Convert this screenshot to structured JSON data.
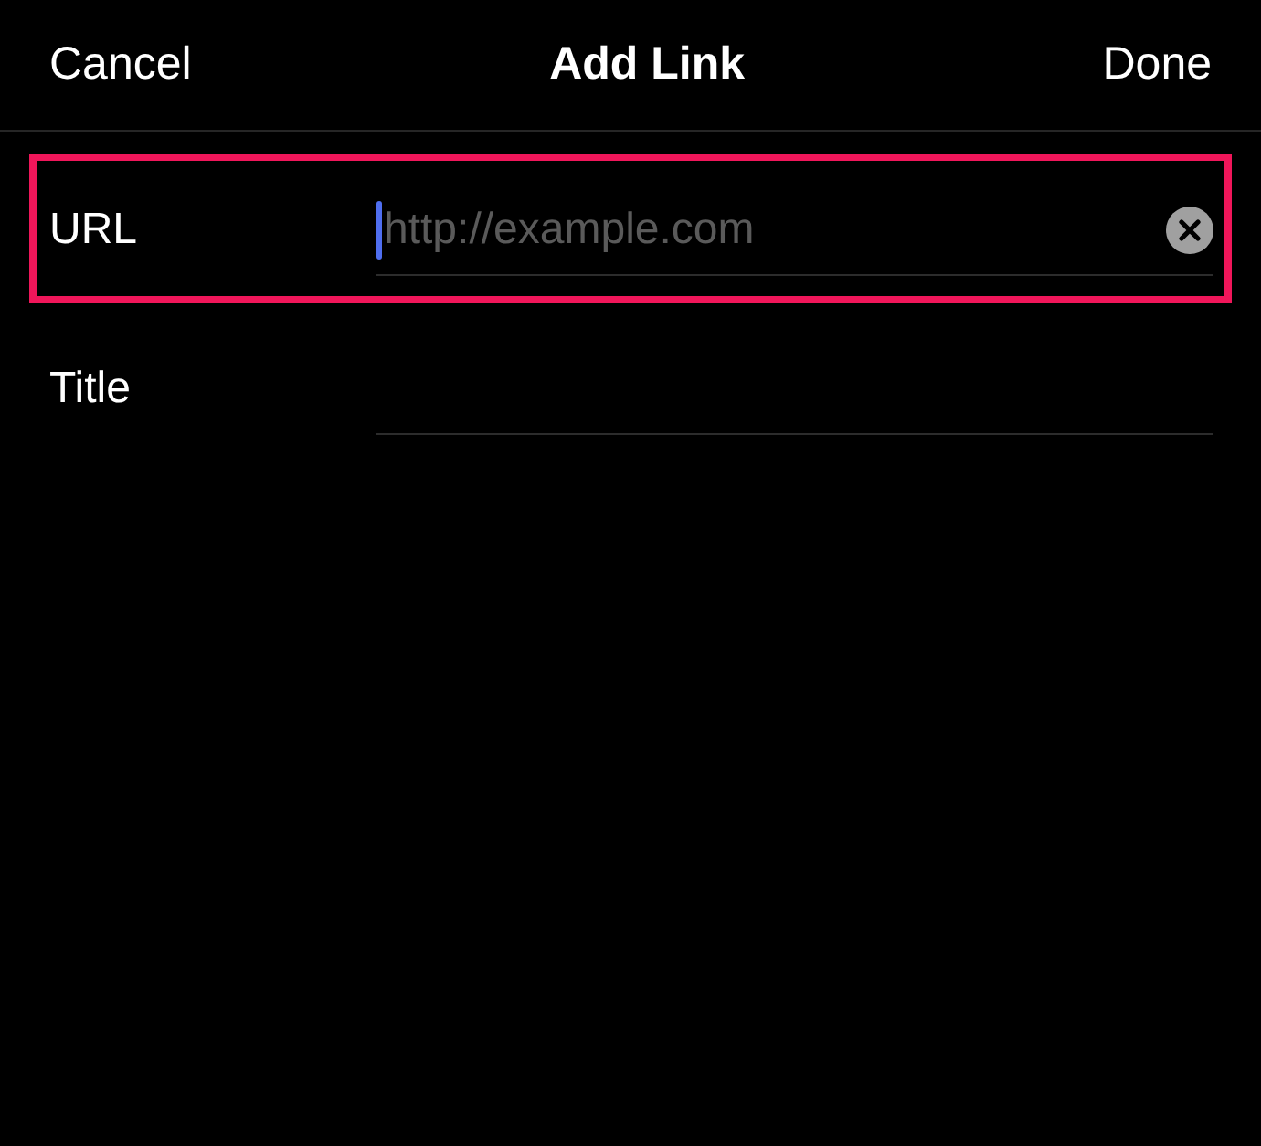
{
  "nav_bar": {
    "cancel": "Cancel",
    "title": "Add Link",
    "done": "Done"
  },
  "fields": [
    {
      "label": "URL",
      "placeholder": "http://example.com",
      "focused": true,
      "clearable": true,
      "highlighted": true
    },
    {
      "label": "Title",
      "focused": false,
      "clearable": false,
      "highlighted": false
    }
  ]
}
